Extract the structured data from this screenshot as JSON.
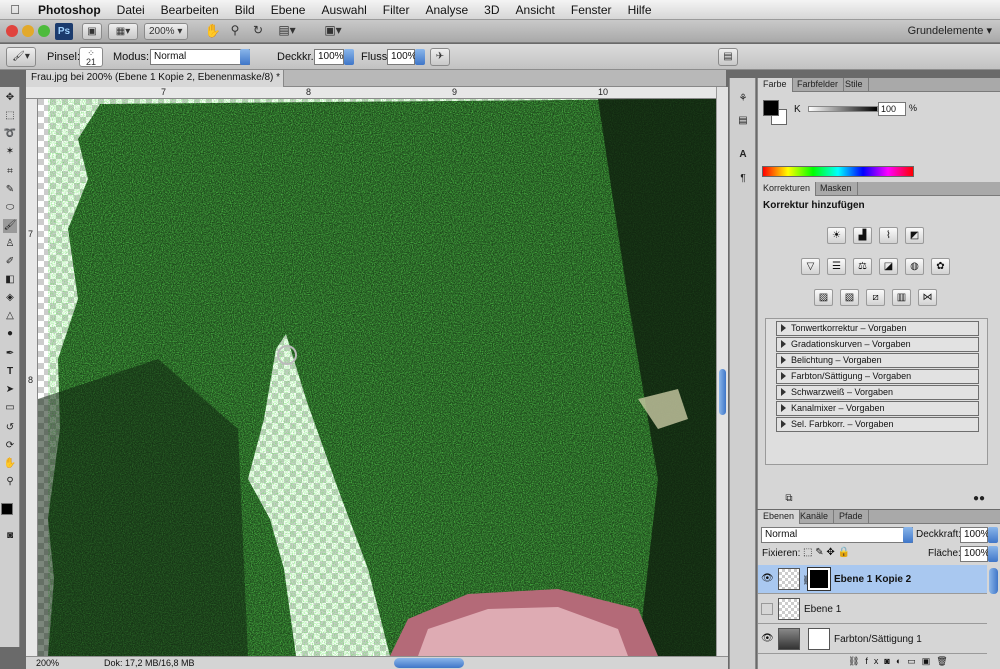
{
  "menubar": {
    "apple": "",
    "app": "Photoshop",
    "items": [
      "Datei",
      "Bearbeiten",
      "Bild",
      "Ebene",
      "Auswahl",
      "Filter",
      "Analyse",
      "3D",
      "Ansicht",
      "Fenster",
      "Hilfe"
    ]
  },
  "appbar": {
    "logo": "Ps",
    "zoom": "200%",
    "workspace": "Grundelemente ▾"
  },
  "options": {
    "pinsel_label": "Pinsel:",
    "brush_size": "21",
    "modus_label": "Modus:",
    "modus_value": "Normal",
    "deckkraft_label": "Deckkr.:",
    "deckkraft_value": "100%",
    "fluss_label": "Fluss:",
    "fluss_value": "100%"
  },
  "document": {
    "tab_title": "Frau.jpg bei 200% (Ebene 1 Kopie 2, Ebenenmaske/8) *"
  },
  "ruler": {
    "h_labels": [
      "7",
      "8",
      "9",
      "10"
    ],
    "v_labels": [
      "7",
      "8"
    ]
  },
  "status": {
    "zoom": "200%",
    "doc": "Dok: 17,2 MB/16,8 MB"
  },
  "colors": {
    "accent": "#3f76c8",
    "selected_layer": "#a9c8f0",
    "grass": "#1e5a1c"
  },
  "color_panel": {
    "tabs": [
      "Farbe",
      "Farbfelder",
      "Stile"
    ],
    "k_label": "K",
    "k_value": "100",
    "k_unit": "%"
  },
  "adjust_panel": {
    "tabs": [
      "Korrekturen",
      "Masken"
    ],
    "title": "Korrektur hinzufügen",
    "presets": [
      "Tonwertkorrektur – Vorgaben",
      "Gradationskurven – Vorgaben",
      "Belichtung – Vorgaben",
      "Farbton/Sättigung – Vorgaben",
      "Schwarzweiß – Vorgaben",
      "Kanalmixer – Vorgaben",
      "Sel. Farbkorr. – Vorgaben"
    ]
  },
  "layers_panel": {
    "tabs": [
      "Ebenen",
      "Kanäle",
      "Pfade"
    ],
    "blend_mode": "Normal",
    "deckkraft_label": "Deckkraft:",
    "deckkraft_value": "100%",
    "fixieren_label": "Fixieren:",
    "flaeche_label": "Fläche:",
    "flaeche_value": "100%",
    "layers": [
      {
        "name": "Ebene 1 Kopie 2",
        "visible": true,
        "selected": true
      },
      {
        "name": "Ebene 1",
        "visible": false,
        "selected": false
      },
      {
        "name": "Farbton/Sättigung 1",
        "visible": true,
        "selected": false
      }
    ]
  }
}
